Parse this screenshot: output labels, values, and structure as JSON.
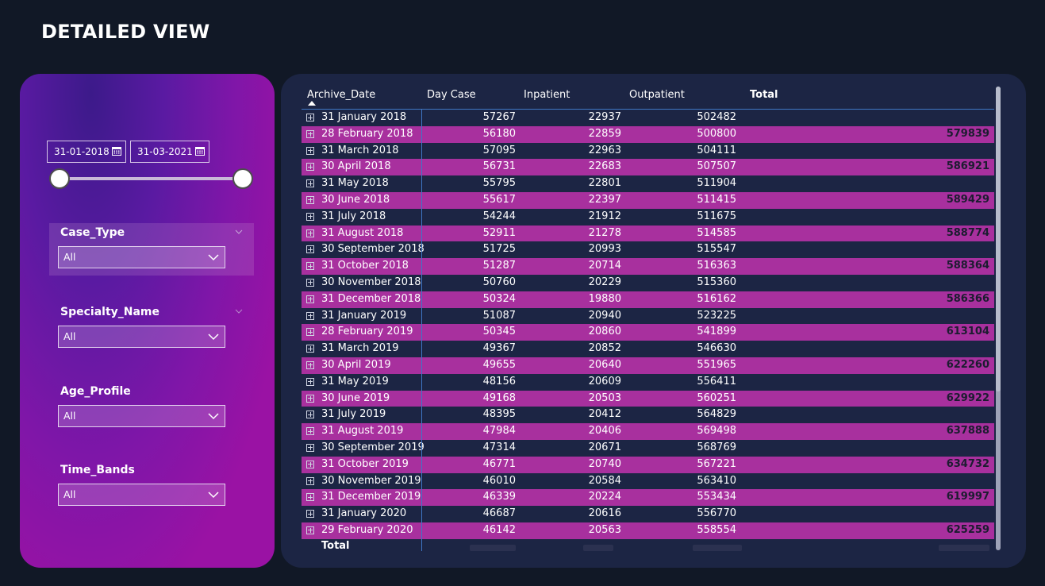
{
  "page": {
    "title": "DETAILED VIEW"
  },
  "filters": {
    "date_range": {
      "start": "31-01-2018",
      "end": "31-03-2021",
      "icon": "calendar-icon"
    },
    "slicers": [
      {
        "label": "Case_Type",
        "value": "All"
      },
      {
        "label": "Specialty_Name",
        "value": "All"
      },
      {
        "label": "Age_Profile",
        "value": "All"
      },
      {
        "label": "Time_Bands",
        "value": "All"
      }
    ]
  },
  "table": {
    "headers": [
      "Archive_Date",
      "Day Case",
      "Inpatient",
      "Outpatient",
      "Total"
    ],
    "sort_indicator": "ascending",
    "rows": [
      {
        "date": "31 January 2018",
        "day_case": "57267",
        "inpatient": "22937",
        "outpatient": "502482",
        "total": ""
      },
      {
        "date": "28 February 2018",
        "day_case": "56180",
        "inpatient": "22859",
        "outpatient": "500800",
        "total": "579839"
      },
      {
        "date": "31 March 2018",
        "day_case": "57095",
        "inpatient": "22963",
        "outpatient": "504111",
        "total": ""
      },
      {
        "date": "30 April 2018",
        "day_case": "56731",
        "inpatient": "22683",
        "outpatient": "507507",
        "total": "586921"
      },
      {
        "date": "31 May 2018",
        "day_case": "55795",
        "inpatient": "22801",
        "outpatient": "511904",
        "total": ""
      },
      {
        "date": "30 June 2018",
        "day_case": "55617",
        "inpatient": "22397",
        "outpatient": "511415",
        "total": "589429"
      },
      {
        "date": "31 July 2018",
        "day_case": "54244",
        "inpatient": "21912",
        "outpatient": "511675",
        "total": ""
      },
      {
        "date": "31 August 2018",
        "day_case": "52911",
        "inpatient": "21278",
        "outpatient": "514585",
        "total": "588774"
      },
      {
        "date": "30 September 2018",
        "day_case": "51725",
        "inpatient": "20993",
        "outpatient": "515547",
        "total": ""
      },
      {
        "date": "31 October 2018",
        "day_case": "51287",
        "inpatient": "20714",
        "outpatient": "516363",
        "total": "588364"
      },
      {
        "date": "30 November 2018",
        "day_case": "50760",
        "inpatient": "20229",
        "outpatient": "515360",
        "total": ""
      },
      {
        "date": "31 December 2018",
        "day_case": "50324",
        "inpatient": "19880",
        "outpatient": "516162",
        "total": "586366"
      },
      {
        "date": "31 January 2019",
        "day_case": "51087",
        "inpatient": "20940",
        "outpatient": "523225",
        "total": ""
      },
      {
        "date": "28 February 2019",
        "day_case": "50345",
        "inpatient": "20860",
        "outpatient": "541899",
        "total": "613104"
      },
      {
        "date": "31 March 2019",
        "day_case": "49367",
        "inpatient": "20852",
        "outpatient": "546630",
        "total": ""
      },
      {
        "date": "30 April 2019",
        "day_case": "49655",
        "inpatient": "20640",
        "outpatient": "551965",
        "total": "622260"
      },
      {
        "date": "31 May 2019",
        "day_case": "48156",
        "inpatient": "20609",
        "outpatient": "556411",
        "total": ""
      },
      {
        "date": "30 June 2019",
        "day_case": "49168",
        "inpatient": "20503",
        "outpatient": "560251",
        "total": "629922"
      },
      {
        "date": "31 July 2019",
        "day_case": "48395",
        "inpatient": "20412",
        "outpatient": "564829",
        "total": ""
      },
      {
        "date": "31 August 2019",
        "day_case": "47984",
        "inpatient": "20406",
        "outpatient": "569498",
        "total": "637888"
      },
      {
        "date": "30 September 2019",
        "day_case": "47314",
        "inpatient": "20671",
        "outpatient": "568769",
        "total": ""
      },
      {
        "date": "31 October 2019",
        "day_case": "46771",
        "inpatient": "20740",
        "outpatient": "567221",
        "total": "634732"
      },
      {
        "date": "30 November 2019",
        "day_case": "46010",
        "inpatient": "20584",
        "outpatient": "563410",
        "total": ""
      },
      {
        "date": "31 December 2019",
        "day_case": "46339",
        "inpatient": "20224",
        "outpatient": "553434",
        "total": "619997"
      },
      {
        "date": "31 January 2020",
        "day_case": "46687",
        "inpatient": "20616",
        "outpatient": "556770",
        "total": ""
      },
      {
        "date": "29 February 2020",
        "day_case": "46142",
        "inpatient": "20563",
        "outpatient": "558554",
        "total": "625259"
      }
    ],
    "total_label": "Total"
  },
  "colors": {
    "background": "#111826",
    "table_panel": "#1c2544",
    "row_highlight": "#a8309e",
    "header_divider": "#3f77c5",
    "filter_gradient_top": "#3c1a8a",
    "filter_gradient_bottom": "#9a12a4"
  }
}
